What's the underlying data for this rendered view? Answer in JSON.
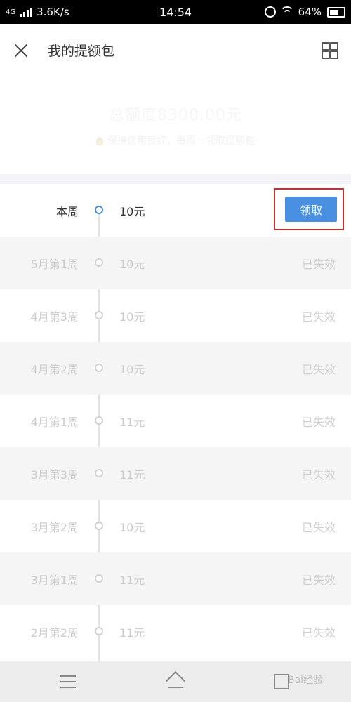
{
  "status_bar": {
    "network": "4G",
    "speed": "3.6K/s",
    "time": "14:54",
    "battery": "64%"
  },
  "header": {
    "title": "我的提额包"
  },
  "summary": {
    "total_label": "总额度8300.00元",
    "tip": "保持信用良好，每周一领取提额包"
  },
  "list": {
    "rows": [
      {
        "week": "本周",
        "amount": "10元",
        "action": "领取"
      },
      {
        "week": "5月第1周",
        "amount": "10元",
        "status": "已失效"
      },
      {
        "week": "4月第3周",
        "amount": "10元",
        "status": "已失效"
      },
      {
        "week": "4月第2周",
        "amount": "10元",
        "status": "已失效"
      },
      {
        "week": "4月第1周",
        "amount": "11元",
        "status": "已失效"
      },
      {
        "week": "3月第3周",
        "amount": "11元",
        "status": "已失效"
      },
      {
        "week": "3月第2周",
        "amount": "10元",
        "status": "已失效"
      },
      {
        "week": "3月第1周",
        "amount": "11元",
        "status": "已失效"
      },
      {
        "week": "2月第2周",
        "amount": "11元",
        "status": "已失效"
      }
    ]
  },
  "colors": {
    "accent": "#4a90e2",
    "highlight_border": "#cc2d2d",
    "inactive_text": "#cccccc"
  },
  "icons": {
    "close": "close-icon",
    "grid": "grid-icon",
    "menu": "menu-icon",
    "home": "home-icon",
    "back": "back-icon"
  },
  "watermark": "Bai经验"
}
